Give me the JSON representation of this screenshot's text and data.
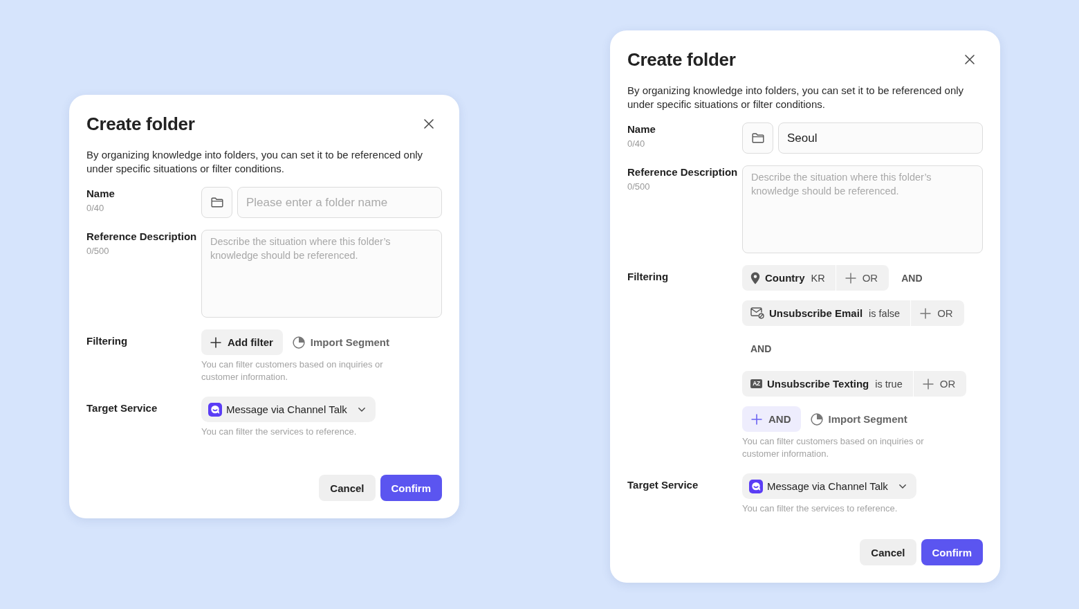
{
  "dialogs": [
    {
      "title": "Create folder",
      "description": "By organizing knowledge into folders, you can set it to be referenced only under specific situations or filter conditions.",
      "name": {
        "label": "Name",
        "counter": "0/40",
        "placeholder": "Please enter a folder name"
      },
      "reference_description": {
        "label": "Reference Description",
        "counter": "0/500",
        "placeholder": "Describe the situation where this folder’s knowledge should be referenced."
      },
      "filtering": {
        "label": "Filtering",
        "add_button": {
          "kind": "plain",
          "label": "Add filter"
        },
        "import_button": "Import Segment",
        "hint": "You can filter customers based on inquiries or customer information."
      },
      "target_service": {
        "label": "Target Service",
        "value": "Message via Channel Talk",
        "hint": "You can filter the services to reference."
      },
      "buttons": {
        "cancel": "Cancel",
        "confirm": "Confirm"
      }
    },
    {
      "title": "Create folder",
      "description": "By organizing knowledge into folders, you can set it to be referenced only under specific situations or filter conditions.",
      "name": {
        "label": "Name",
        "counter": "0/40",
        "value": "Seoul"
      },
      "reference_description": {
        "label": "Reference Description",
        "counter": "0/500",
        "placeholder": "Describe the situation where this folder’s knowledge should be referenced."
      },
      "filtering": {
        "label": "Filtering",
        "items": [
          {
            "kind": "location",
            "attribute": "Country",
            "value": "KR",
            "or_label": "OR",
            "and_label": "AND"
          },
          {
            "kind": "email",
            "attribute": "Unsubscribe Email",
            "value": "is false",
            "or_label": "OR"
          },
          {
            "kind": "operator",
            "label": "AND"
          },
          {
            "kind": "text",
            "badge": "AZ",
            "attribute": "Unsubscribe Texting",
            "value": "is true",
            "or_label": "OR"
          }
        ],
        "add_button": {
          "kind": "accent",
          "label": "AND"
        },
        "import_button": "Import Segment",
        "hint": "You can filter customers based on inquiries or customer information."
      },
      "target_service": {
        "label": "Target Service",
        "value": "Message via Channel Talk",
        "hint": "You can filter the services to reference."
      },
      "buttons": {
        "cancel": "Cancel",
        "confirm": "Confirm"
      }
    }
  ]
}
